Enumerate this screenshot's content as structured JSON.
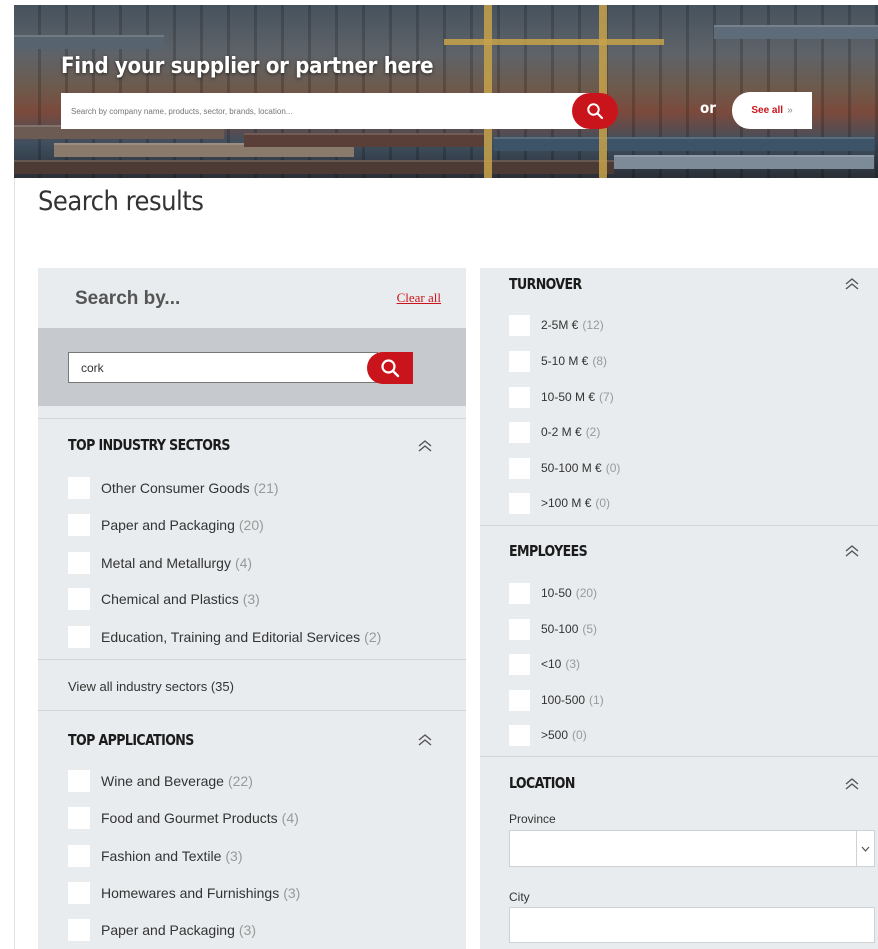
{
  "hero": {
    "title": "Find your supplier or partner here",
    "search_placeholder": "Search by company name, products, sector, brands, location...",
    "or_label": "or",
    "see_all_label": "See all",
    "see_all_arrow": "»"
  },
  "page": {
    "title": "Search results"
  },
  "filters": {
    "search_by_label": "Search by...",
    "clear_all_label": "Clear all",
    "search_value": "cork",
    "industry_sectors": {
      "heading": "TOP INDUSTRY SECTORS",
      "items": [
        {
          "label": "Other Consumer Goods",
          "count": "(21)"
        },
        {
          "label": "Paper and Packaging",
          "count": "(20)"
        },
        {
          "label": "Metal and Metallurgy",
          "count": "(4)"
        },
        {
          "label": "Chemical and Plastics",
          "count": "(3)"
        },
        {
          "label": "Education, Training and Editorial Services",
          "count": "(2)"
        }
      ],
      "view_all_label": "View all industry sectors (35)"
    },
    "applications": {
      "heading": "TOP APPLICATIONS",
      "items": [
        {
          "label": "Wine and Beverage",
          "count": "(22)"
        },
        {
          "label": "Food and Gourmet Products",
          "count": "(4)"
        },
        {
          "label": "Fashion and Textile",
          "count": "(3)"
        },
        {
          "label": "Homewares and Furnishings",
          "count": "(3)"
        },
        {
          "label": "Paper and Packaging",
          "count": "(3)"
        }
      ]
    },
    "turnover": {
      "heading": "TURNOVER",
      "items": [
        {
          "label": "2-5M €",
          "count": "(12)"
        },
        {
          "label": "5-10 M €",
          "count": "(8)"
        },
        {
          "label": "10-50 M €",
          "count": "(7)"
        },
        {
          "label": "0-2 M €",
          "count": "(2)"
        },
        {
          "label": "50-100 M €",
          "count": "(0)"
        },
        {
          "label": ">100 M €",
          "count": "(0)"
        }
      ]
    },
    "employees": {
      "heading": "EMPLOYEES",
      "items": [
        {
          "label": "10-50",
          "count": "(20)"
        },
        {
          "label": "50-100",
          "count": "(5)"
        },
        {
          "label": "<10",
          "count": "(3)"
        },
        {
          "label": "100-500",
          "count": "(1)"
        },
        {
          "label": ">500",
          "count": "(0)"
        }
      ]
    },
    "location": {
      "heading": "LOCATION",
      "province_label": "Province",
      "city_label": "City"
    }
  },
  "colors": {
    "accent": "#c9141b",
    "panel": "#e9ecee",
    "search_band": "#c6c9cd"
  }
}
